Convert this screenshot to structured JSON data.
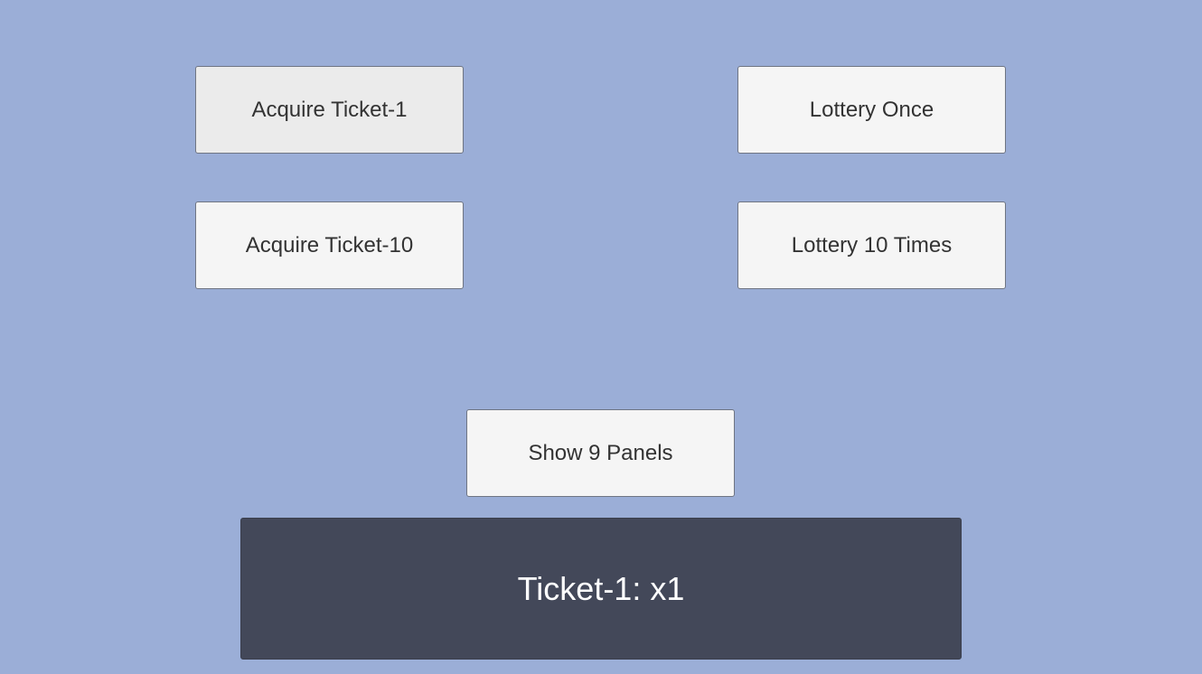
{
  "colors": {
    "background": "#9baed7",
    "button_bg": "#f5f5f5",
    "button_hover_bg": "#ebebeb",
    "button_border": "#6f7583",
    "button_text": "#333333",
    "panel_bg": "#434859",
    "panel_text": "#ffffff"
  },
  "buttons": {
    "acquire_ticket_1": "Acquire Ticket-1",
    "lottery_once": "Lottery Once",
    "acquire_ticket_10": "Acquire Ticket-10",
    "lottery_10_times": "Lottery 10 Times",
    "show_9_panels": "Show 9 Panels"
  },
  "ticket_panel": {
    "text": "Ticket-1: x1"
  }
}
